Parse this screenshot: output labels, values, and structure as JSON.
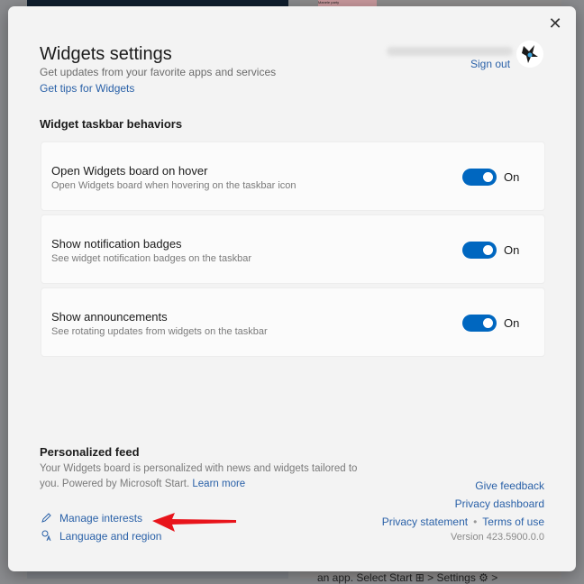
{
  "background": {
    "card_label": "Manele party",
    "bottom_text": "an app. Select Start ⊞ > Settings ⚙ >"
  },
  "modal": {
    "title": "Widgets settings",
    "subtitle": "Get updates from your favorite apps and services",
    "tips_link": "Get tips for Widgets",
    "sign_out": "Sign out",
    "close_icon": "close-icon"
  },
  "taskbar_behaviors": {
    "heading": "Widget taskbar behaviors",
    "items": [
      {
        "title": "Open Widgets board on hover",
        "description": "Open Widgets board when hovering on the taskbar icon",
        "state": "On",
        "enabled": true
      },
      {
        "title": "Show notification badges",
        "description": "See widget notification badges on the taskbar",
        "state": "On",
        "enabled": true
      },
      {
        "title": "Show announcements",
        "description": "See rotating updates from widgets on the taskbar",
        "state": "On",
        "enabled": true
      }
    ]
  },
  "personalized_feed": {
    "heading": "Personalized feed",
    "description": "Your Widgets board is personalized with news and widgets tailored to you. Powered by Microsoft Start.",
    "learn_more": "Learn more",
    "manage_interests": "Manage interests",
    "language_region": "Language and region"
  },
  "footer": {
    "give_feedback": "Give feedback",
    "privacy_dashboard": "Privacy dashboard",
    "privacy_statement": "Privacy statement",
    "separator": "•",
    "terms_of_use": "Terms of use",
    "version": "Version 423.5900.0.0"
  },
  "colors": {
    "accent": "#0067c0",
    "link": "#2a61a8",
    "annotation_arrow": "#e8141b"
  }
}
